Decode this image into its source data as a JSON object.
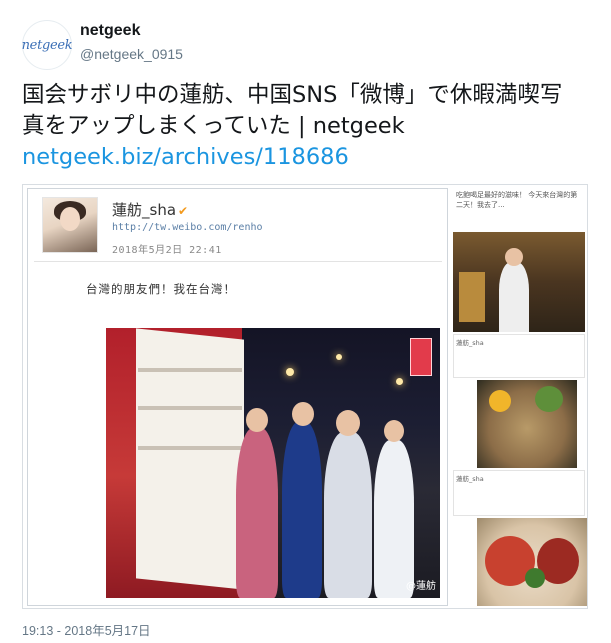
{
  "account": {
    "display_name": "netgeek",
    "handle": "@netgeek_0915",
    "avatar_text": "netgeek"
  },
  "tweet": {
    "text": "国会サボリ中の蓮舫、中国SNS「微博」で休暇満喫写真をアップしまくっていた | netgeek",
    "link": "netgeek.biz/archives/118686",
    "timestamp": "19:13 - 2018年5月17日"
  },
  "embedded_weibo": {
    "name": "蓮舫_sha",
    "url": "http://tw.weibo.com/renho",
    "date": "2018年5月2日 22:41",
    "post_text": "台灣的朋友們！我在台灣！",
    "watermark": "@蓮舫",
    "verified_icon": "verified-v-icon",
    "right_caption": "吃飽喝足最好的滋味！ 今天來台灣的第二天！我去了..."
  },
  "colors": {
    "link": "#1b95e0",
    "secondary_text": "#657786",
    "weibo_verified": "#f39a1d"
  }
}
